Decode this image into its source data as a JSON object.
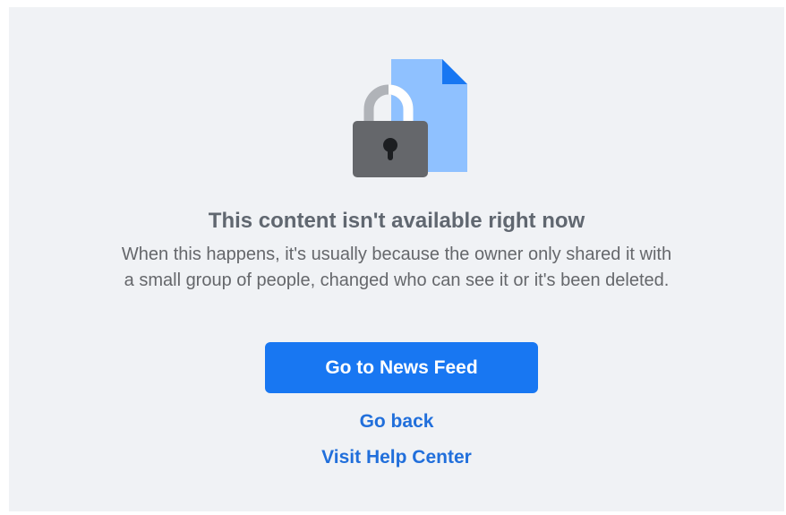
{
  "error_page": {
    "title": "This content isn't available right now",
    "message": "When this happens, it's usually because the owner only shared it with a small group of people, changed who can see it or it's been deleted.",
    "primary_button_label": "Go to News Feed",
    "back_link_label": "Go back",
    "help_link_label": "Visit Help Center",
    "illustration_icons": [
      "lock-icon",
      "document-icon"
    ]
  },
  "colors": {
    "background": "#f0f2f5",
    "title": "#606770",
    "body_text": "#65676b",
    "primary": "#1877f2",
    "link": "#216fdb",
    "document": "#8fc1ff",
    "document_fold": "#1877f2",
    "lock_body": "#65676b",
    "lock_shackle": "#b0b3b8"
  }
}
